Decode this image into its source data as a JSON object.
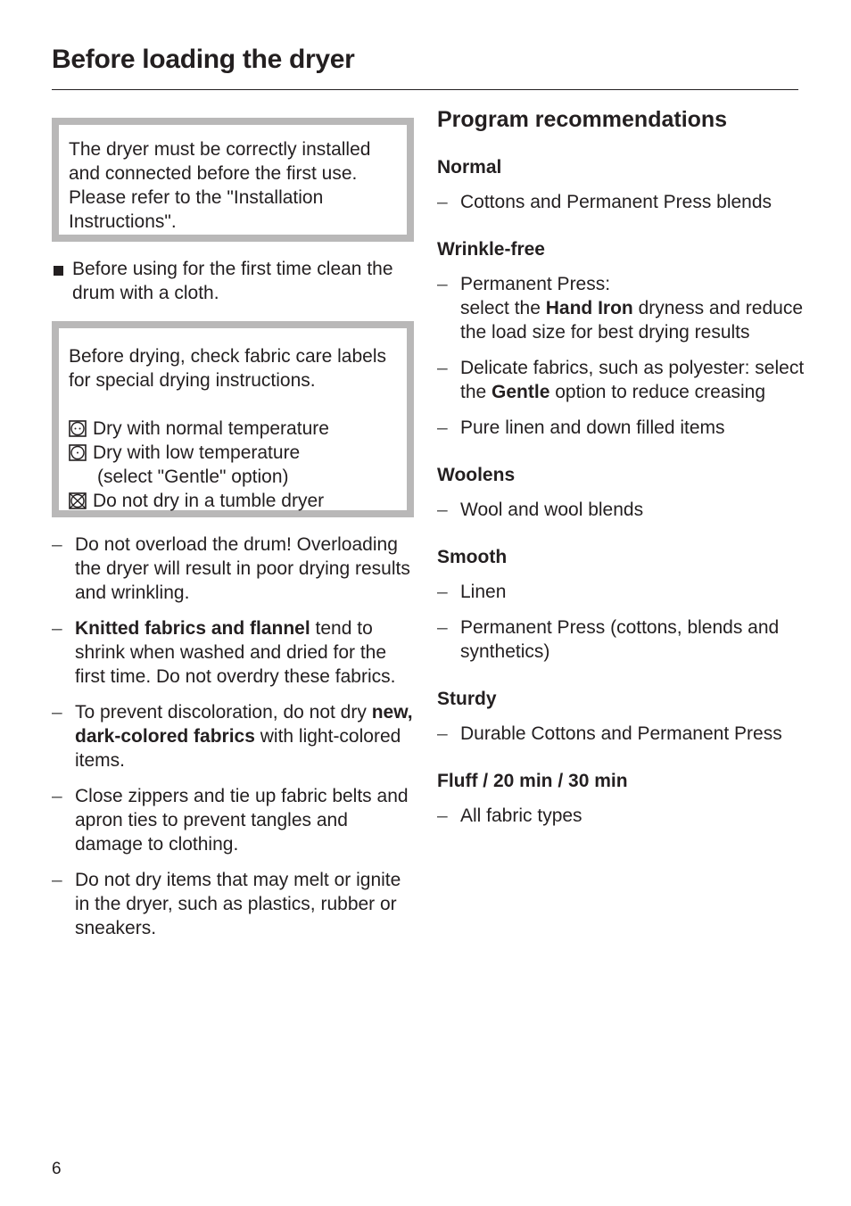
{
  "page": {
    "title": "Before loading the dryer",
    "page_number": "6"
  },
  "left": {
    "note_installation": "The dryer must be correctly installed and connected before the first use. Please refer to the \"Installation Instructions\".",
    "bullet_clean": "Before using for the first time clean the drum with a cloth.",
    "note_care_labels": {
      "intro": "Before drying, check fabric care labels for special drying instructions.",
      "symbols": [
        {
          "icon": "tumble-dry-normal-icon",
          "text": "Dry with normal temperature"
        },
        {
          "icon": "tumble-dry-low-icon",
          "text": "Dry with low temperature",
          "subtext": "(select \"Gentle\" option)"
        },
        {
          "icon": "do-not-tumble-dry-icon",
          "text": "Do not dry in a tumble dryer"
        }
      ]
    },
    "tips": [
      {
        "pre": "",
        "bold": "",
        "post": "Do not overload the drum! Overloading the dryer will result in poor drying results and wrinkling."
      },
      {
        "pre": "",
        "bold": "Knitted fabrics and flannel",
        "post": " tend to shrink when washed and dried for the first time. Do not overdry these fabrics."
      },
      {
        "pre": "To prevent discoloration, do not dry ",
        "bold": "new, dark-colored fabrics",
        "post": " with light-colored items."
      },
      {
        "pre": "",
        "bold": "",
        "post": "Close zippers and tie up fabric belts and apron ties to prevent tangles and damage to clothing."
      },
      {
        "pre": "",
        "bold": "",
        "post": "Do not dry items that may melt or ignite in the dryer, such as plastics, rubber or sneakers."
      }
    ]
  },
  "right": {
    "heading": "Program recommendations",
    "programs": [
      {
        "name": "Normal",
        "items": [
          {
            "lines": [
              {
                "pre": "Cottons and Permanent Press blends",
                "bold": "",
                "post": ""
              }
            ]
          }
        ]
      },
      {
        "name": "Wrinkle-free",
        "items": [
          {
            "lines": [
              {
                "pre": "Permanent Press:",
                "bold": "",
                "post": ""
              },
              {
                "pre": "select the ",
                "bold": "Hand Iron",
                "post": " dryness and reduce the load size for best drying results"
              }
            ]
          },
          {
            "lines": [
              {
                "pre": "Delicate fabrics, such as polyester: select the ",
                "bold": "Gentle",
                "post": " option to reduce creasing"
              }
            ]
          },
          {
            "lines": [
              {
                "pre": "Pure linen and down filled items",
                "bold": "",
                "post": ""
              }
            ]
          }
        ]
      },
      {
        "name": "Woolens",
        "items": [
          {
            "lines": [
              {
                "pre": "Wool and wool blends",
                "bold": "",
                "post": ""
              }
            ]
          }
        ]
      },
      {
        "name": "Smooth",
        "items": [
          {
            "lines": [
              {
                "pre": "Linen",
                "bold": "",
                "post": ""
              }
            ]
          },
          {
            "lines": [
              {
                "pre": "Permanent Press (cottons, blends and synthetics)",
                "bold": "",
                "post": ""
              }
            ]
          }
        ]
      },
      {
        "name": "Sturdy",
        "items": [
          {
            "lines": [
              {
                "pre": "Durable Cottons and Permanent Press",
                "bold": "",
                "post": ""
              }
            ]
          }
        ]
      },
      {
        "name": "Fluff / 20 min / 30 min",
        "items": [
          {
            "lines": [
              {
                "pre": "All fabric types",
                "bold": "",
                "post": ""
              }
            ]
          }
        ]
      }
    ]
  },
  "dash_glyph": "–"
}
